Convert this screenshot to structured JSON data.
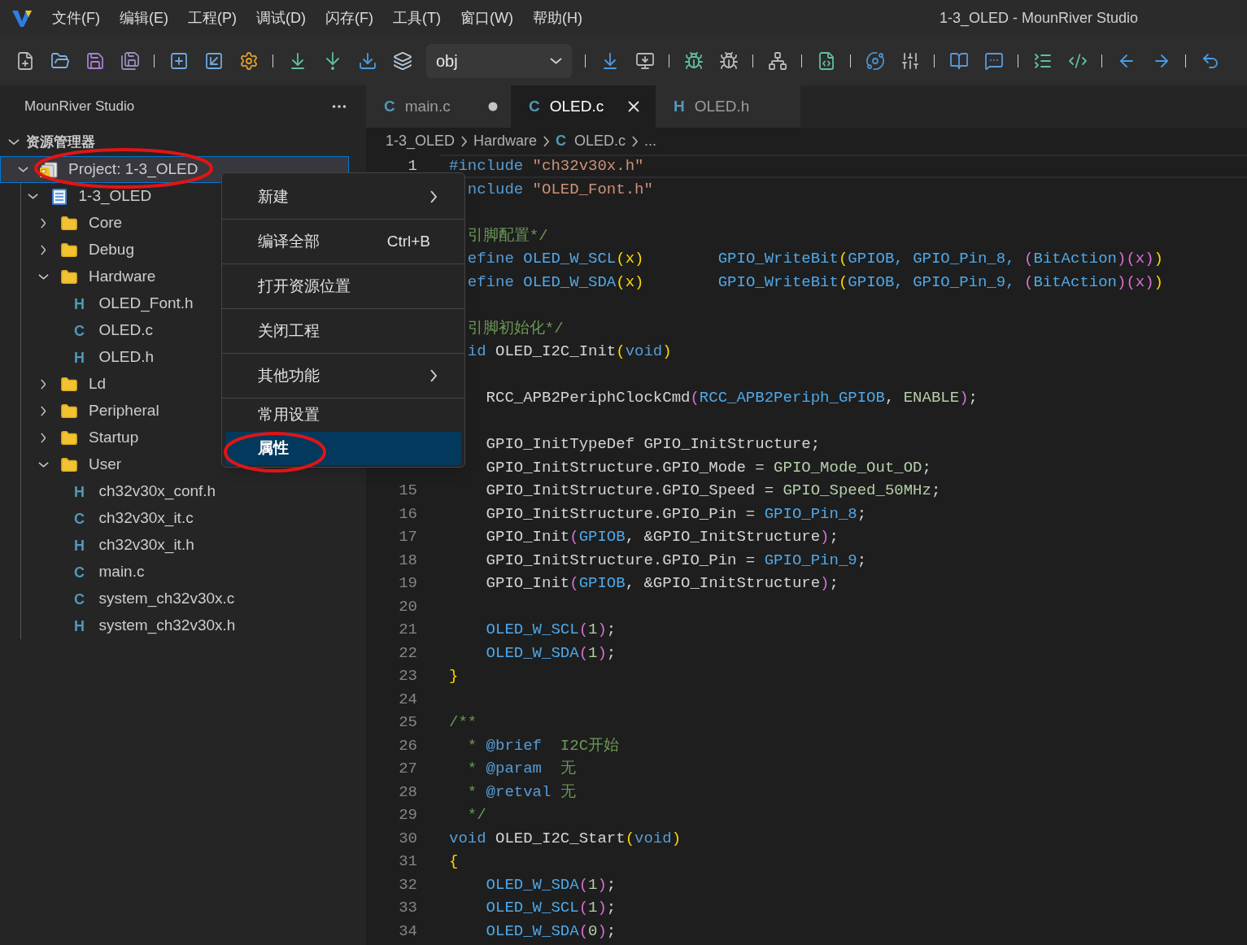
{
  "window": {
    "title": "1-3_OLED - MounRiver Studio"
  },
  "menu_bar": {
    "items": [
      "文件(F)",
      "编辑(E)",
      "工程(P)",
      "调试(D)",
      "闪存(F)",
      "工具(T)",
      "窗口(W)",
      "帮助(H)"
    ]
  },
  "toolbar": {
    "configuration": {
      "value": "obj"
    }
  },
  "sidebar": {
    "title": "MounRiver Studio",
    "section": {
      "label": "资源管理器",
      "expanded": true
    },
    "tree": [
      {
        "label": "Project: 1-3_OLED",
        "kind": "project",
        "expanded": true,
        "selected": true,
        "children": [
          {
            "label": "1-3_OLED",
            "kind": "workspace",
            "expanded": true,
            "selected": false,
            "children": [
              {
                "label": "Core",
                "kind": "folder",
                "expanded": false,
                "selected": false
              },
              {
                "label": "Debug",
                "kind": "folder",
                "expanded": false,
                "selected": false
              },
              {
                "label": "Hardware",
                "kind": "folder",
                "expanded": true,
                "selected": false,
                "children": [
                  {
                    "label": "OLED_Font.h",
                    "kind": "file",
                    "badge": "H",
                    "selected": false
                  },
                  {
                    "label": "OLED.c",
                    "kind": "file",
                    "badge": "C",
                    "selected": false
                  },
                  {
                    "label": "OLED.h",
                    "kind": "file",
                    "badge": "H",
                    "selected": false
                  }
                ]
              },
              {
                "label": "Ld",
                "kind": "folder",
                "expanded": false,
                "selected": false
              },
              {
                "label": "Peripheral",
                "kind": "folder",
                "expanded": false,
                "selected": false
              },
              {
                "label": "Startup",
                "kind": "folder",
                "expanded": false,
                "selected": false
              },
              {
                "label": "User",
                "kind": "folder",
                "expanded": true,
                "selected": false,
                "children": [
                  {
                    "label": "ch32v30x_conf.h",
                    "kind": "file",
                    "badge": "H",
                    "selected": false
                  },
                  {
                    "label": "ch32v30x_it.c",
                    "kind": "file",
                    "badge": "C",
                    "selected": false
                  },
                  {
                    "label": "ch32v30x_it.h",
                    "kind": "file",
                    "badge": "H",
                    "selected": false
                  },
                  {
                    "label": "main.c",
                    "kind": "file",
                    "badge": "C",
                    "selected": false
                  },
                  {
                    "label": "system_ch32v30x.c",
                    "kind": "file",
                    "badge": "C",
                    "selected": false
                  },
                  {
                    "label": "system_ch32v30x.h",
                    "kind": "file",
                    "badge": "H",
                    "selected": false
                  }
                ]
              }
            ]
          }
        ]
      }
    ]
  },
  "context_menu": {
    "items": [
      {
        "label": "新建",
        "submenu": true,
        "selected": false,
        "divider_after": true
      },
      {
        "label": "编译全部",
        "shortcut": "Ctrl+B",
        "submenu": false,
        "selected": false,
        "divider_after": true
      },
      {
        "label": "打开资源位置",
        "submenu": false,
        "selected": false,
        "divider_after": true
      },
      {
        "label": "关闭工程",
        "submenu": false,
        "selected": false,
        "divider_after": true
      },
      {
        "label": "其他功能",
        "submenu": true,
        "selected": false,
        "divider_after": true
      },
      {
        "label": "常用设置",
        "submenu": false,
        "selected": false,
        "divider_after": false
      },
      {
        "label": "属性",
        "submenu": false,
        "selected": true,
        "divider_after": false
      }
    ]
  },
  "editor": {
    "tabs": [
      {
        "badge": "C",
        "label": "main.c",
        "selected": false,
        "modified": true
      },
      {
        "badge": "C",
        "label": "OLED.c",
        "selected": true,
        "modified": false
      },
      {
        "badge": "H",
        "label": "OLED.h",
        "selected": false,
        "modified": false
      }
    ],
    "breadcrumb": [
      {
        "label": "1-3_OLED"
      },
      {
        "label": "Hardware"
      },
      {
        "badge": "C",
        "label": "OLED.c"
      },
      {
        "label": "..."
      }
    ],
    "lines": [
      {
        "number": "1",
        "current": true,
        "tokens": [
          {
            "kind": "keyword",
            "text": "#include"
          },
          {
            "kind": "string",
            "text": " \"ch32v30x.h\""
          }
        ]
      },
      {
        "current": false,
        "tokens": [
          {
            "kind": "keyword",
            "text": "  nclude"
          },
          {
            "kind": "string",
            "text": " \"OLED_Font.h\""
          }
        ]
      },
      {
        "current": false
      },
      {
        "current": false,
        "tokens": [
          {
            "kind": "comment",
            "text": "  引脚配置*/"
          }
        ]
      },
      {
        "current": false,
        "tokens": [
          {
            "kind": "keyword",
            "text": "  efine"
          },
          {
            "kind": "macro",
            "text": " OLED_W_SCL"
          },
          {
            "kind": "bracket1",
            "text": "(x)"
          },
          {
            "kind": "macro",
            "text": "        GPIO_WriteBit"
          },
          {
            "kind": "bracket1",
            "text": "("
          },
          {
            "kind": "macro",
            "text": "GPIOB, GPIO_Pin_8, "
          },
          {
            "kind": "bracket2",
            "text": "("
          },
          {
            "kind": "macro",
            "text": "BitAction"
          },
          {
            "kind": "bracket2",
            "text": ")(x)"
          },
          {
            "kind": "bracket1",
            "text": ")"
          }
        ]
      },
      {
        "current": false,
        "tokens": [
          {
            "kind": "keyword",
            "text": "  efine"
          },
          {
            "kind": "macro",
            "text": " OLED_W_SDA"
          },
          {
            "kind": "bracket1",
            "text": "(x)"
          },
          {
            "kind": "macro",
            "text": "        GPIO_WriteBit"
          },
          {
            "kind": "bracket1",
            "text": "("
          },
          {
            "kind": "macro",
            "text": "GPIOB, GPIO_Pin_9, "
          },
          {
            "kind": "bracket2",
            "text": "("
          },
          {
            "kind": "macro",
            "text": "BitAction"
          },
          {
            "kind": "bracket2",
            "text": ")(x)"
          },
          {
            "kind": "bracket1",
            "text": ")"
          }
        ]
      },
      {
        "current": false
      },
      {
        "current": false,
        "tokens": [
          {
            "kind": "comment",
            "text": "  引脚初始化*/"
          }
        ]
      },
      {
        "current": false,
        "tokens": [
          {
            "kind": "keyword",
            "text": "  id"
          },
          {
            "kind": "plain",
            "text": " OLED_I2C_Init"
          },
          {
            "kind": "bracket1",
            "text": "("
          },
          {
            "kind": "keyword",
            "text": "void"
          },
          {
            "kind": "bracket1",
            "text": ")"
          }
        ]
      },
      {
        "current": false
      },
      {
        "current": false,
        "tokens": [
          {
            "kind": "plain",
            "text": "    RCC_APB2PeriphClockCmd"
          },
          {
            "kind": "bracket2",
            "text": "("
          },
          {
            "kind": "macro",
            "text": "RCC_APB2Periph_GPIOB"
          },
          {
            "kind": "plain",
            "text": ", "
          },
          {
            "kind": "constant",
            "text": "ENABLE"
          },
          {
            "kind": "bracket2",
            "text": ")"
          },
          {
            "kind": "plain",
            "text": ";"
          }
        ]
      },
      {
        "current": false
      },
      {
        "current": false,
        "tokens": [
          {
            "kind": "plain",
            "text": "    GPIO_InitTypeDef GPIO_InitStructure;"
          }
        ]
      },
      {
        "current": false,
        "tokens": [
          {
            "kind": "plain",
            "text": "    GPIO_InitStructure.GPIO_Mode = "
          },
          {
            "kind": "constant",
            "text": "GPIO_Mode_Out_OD"
          },
          {
            "kind": "plain",
            "text": ";"
          }
        ]
      },
      {
        "number": "15",
        "current": false,
        "tokens": [
          {
            "kind": "plain",
            "text": "    GPIO_InitStructure.GPIO_Speed = "
          },
          {
            "kind": "constant",
            "text": "GPIO_Speed_50MHz"
          },
          {
            "kind": "plain",
            "text": ";"
          }
        ]
      },
      {
        "number": "16",
        "current": false,
        "tokens": [
          {
            "kind": "plain",
            "text": "    GPIO_InitStructure.GPIO_Pin = "
          },
          {
            "kind": "macro",
            "text": "GPIO_Pin_8"
          },
          {
            "kind": "plain",
            "text": ";"
          }
        ]
      },
      {
        "number": "17",
        "current": false,
        "tokens": [
          {
            "kind": "plain",
            "text": "    GPIO_Init"
          },
          {
            "kind": "bracket2",
            "text": "("
          },
          {
            "kind": "macro",
            "text": "GPIOB"
          },
          {
            "kind": "plain",
            "text": ", &GPIO_InitStructure"
          },
          {
            "kind": "bracket2",
            "text": ")"
          },
          {
            "kind": "plain",
            "text": ";"
          }
        ]
      },
      {
        "number": "18",
        "current": false,
        "tokens": [
          {
            "kind": "plain",
            "text": "    GPIO_InitStructure.GPIO_Pin = "
          },
          {
            "kind": "macro",
            "text": "GPIO_Pin_9"
          },
          {
            "kind": "plain",
            "text": ";"
          }
        ]
      },
      {
        "number": "19",
        "current": false,
        "tokens": [
          {
            "kind": "plain",
            "text": "    GPIO_Init"
          },
          {
            "kind": "bracket2",
            "text": "("
          },
          {
            "kind": "macro",
            "text": "GPIOB"
          },
          {
            "kind": "plain",
            "text": ", &GPIO_InitStructure"
          },
          {
            "kind": "bracket2",
            "text": ")"
          },
          {
            "kind": "plain",
            "text": ";"
          }
        ]
      },
      {
        "number": "20",
        "current": false
      },
      {
        "number": "21",
        "current": false,
        "tokens": [
          {
            "kind": "macro",
            "text": "    OLED_W_SCL"
          },
          {
            "kind": "bracket2",
            "text": "("
          },
          {
            "kind": "constant",
            "text": "1"
          },
          {
            "kind": "bracket2",
            "text": ")"
          },
          {
            "kind": "plain",
            "text": ";"
          }
        ]
      },
      {
        "number": "22",
        "current": false,
        "tokens": [
          {
            "kind": "macro",
            "text": "    OLED_W_SDA"
          },
          {
            "kind": "bracket2",
            "text": "("
          },
          {
            "kind": "constant",
            "text": "1"
          },
          {
            "kind": "bracket2",
            "text": ")"
          },
          {
            "kind": "plain",
            "text": ";"
          }
        ]
      },
      {
        "number": "23",
        "current": false,
        "tokens": [
          {
            "kind": "bracket1",
            "text": "}"
          }
        ]
      },
      {
        "number": "24",
        "current": false
      },
      {
        "number": "25",
        "current": false,
        "tokens": [
          {
            "kind": "comment",
            "text": "/**"
          }
        ]
      },
      {
        "number": "26",
        "current": false,
        "tokens": [
          {
            "kind": "comment",
            "text": "  * "
          },
          {
            "kind": "doctag",
            "text": "@brief"
          },
          {
            "kind": "comment",
            "text": "  I2C开始"
          }
        ]
      },
      {
        "number": "27",
        "current": false,
        "tokens": [
          {
            "kind": "comment",
            "text": "  * "
          },
          {
            "kind": "doctag",
            "text": "@param"
          },
          {
            "kind": "comment",
            "text": "  无"
          }
        ]
      },
      {
        "number": "28",
        "current": false,
        "tokens": [
          {
            "kind": "comment",
            "text": "  * "
          },
          {
            "kind": "doctag",
            "text": "@retval"
          },
          {
            "kind": "comment",
            "text": " 无"
          }
        ]
      },
      {
        "number": "29",
        "current": false,
        "tokens": [
          {
            "kind": "comment",
            "text": "  */"
          }
        ]
      },
      {
        "number": "30",
        "current": false,
        "tokens": [
          {
            "kind": "keyword",
            "text": "void"
          },
          {
            "kind": "plain",
            "text": " OLED_I2C_Start"
          },
          {
            "kind": "bracket1",
            "text": "("
          },
          {
            "kind": "keyword",
            "text": "void"
          },
          {
            "kind": "bracket1",
            "text": ")"
          }
        ]
      },
      {
        "number": "31",
        "current": false,
        "tokens": [
          {
            "kind": "bracket1",
            "text": "{"
          }
        ]
      },
      {
        "number": "32",
        "current": false,
        "tokens": [
          {
            "kind": "macro",
            "text": "    OLED_W_SDA"
          },
          {
            "kind": "bracket2",
            "text": "("
          },
          {
            "kind": "constant",
            "text": "1"
          },
          {
            "kind": "bracket2",
            "text": ")"
          },
          {
            "kind": "plain",
            "text": ";"
          }
        ]
      },
      {
        "number": "33",
        "current": false,
        "tokens": [
          {
            "kind": "macro",
            "text": "    OLED_W_SCL"
          },
          {
            "kind": "bracket2",
            "text": "("
          },
          {
            "kind": "constant",
            "text": "1"
          },
          {
            "kind": "bracket2",
            "text": ")"
          },
          {
            "kind": "plain",
            "text": ";"
          }
        ]
      },
      {
        "number": "34",
        "current": false,
        "tokens": [
          {
            "kind": "macro",
            "text": "    OLED_W_SDA"
          },
          {
            "kind": "bracket2",
            "text": "("
          },
          {
            "kind": "constant",
            "text": "0"
          },
          {
            "kind": "bracket2",
            "text": ")"
          },
          {
            "kind": "plain",
            "text": ";"
          }
        ]
      }
    ]
  }
}
